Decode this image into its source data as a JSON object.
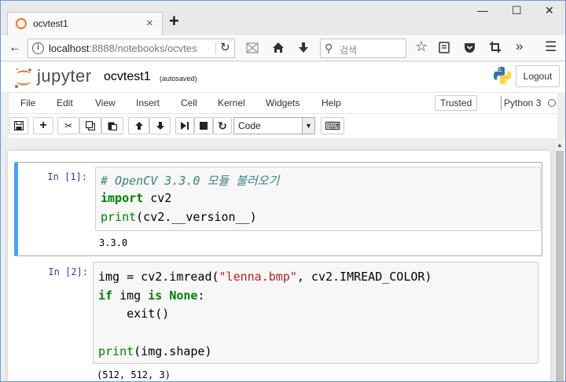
{
  "browser": {
    "tab_title": "ocvtest1",
    "tab_close": "×",
    "new_tab": "+",
    "win_min": "—",
    "win_max": "☐",
    "win_close": "✕",
    "url_host": "localhost",
    "url_rest": ":8888/notebooks/ocvtes",
    "search_placeholder": "검색",
    "back_glyph": "←",
    "reload_glyph": "↻",
    "overflow_glyph": "»",
    "menu_glyph": "☰"
  },
  "jupyter": {
    "logo_text": "jupyter",
    "notebook_name": "ocvtest1",
    "autosave_status": "(autosaved)",
    "logout_label": "Logout"
  },
  "menu": {
    "items": [
      "File",
      "Edit",
      "View",
      "Insert",
      "Cell",
      "Kernel",
      "Widgets",
      "Help"
    ],
    "trusted_label": "Trusted",
    "kernel_name": "Python 3"
  },
  "toolbar": {
    "cell_type": "Code",
    "keyboard_glyph": "⌨"
  },
  "cells": [
    {
      "prompt": "In [1]:",
      "lines": [
        "# OpenCV 3.3.0 모듈 불러오기",
        "import cv2",
        "print(cv2.__version__)"
      ],
      "output": "3.3.0"
    },
    {
      "prompt": "In [2]:",
      "lines": [
        "img = cv2.imread(\"lenna.bmp\", cv2.IMREAD_COLOR)",
        "if img is None:",
        "    exit()",
        "",
        "print(img.shape)"
      ],
      "output": "(512, 512, 3)"
    }
  ],
  "colors": {
    "selected_cell": "#42a5f5",
    "prompt": "#303f9f",
    "keyword": "#008000",
    "string": "#ba2121",
    "comment": "#408080"
  }
}
